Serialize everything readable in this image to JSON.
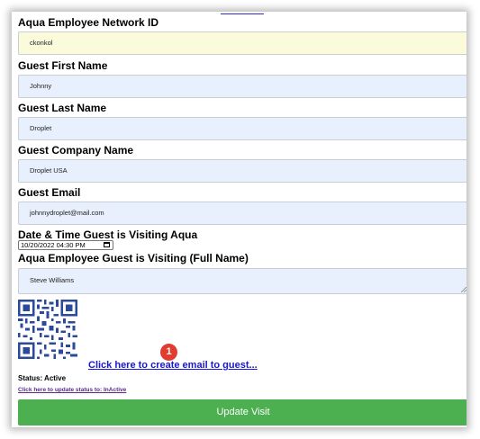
{
  "form": {
    "employee_id": {
      "label": "Aqua Employee Network ID",
      "value": "ckonkol"
    },
    "first_name": {
      "label": "Guest First Name",
      "value": "Johnny"
    },
    "last_name": {
      "label": "Guest Last Name",
      "value": "Droplet"
    },
    "company": {
      "label": "Guest Company Name",
      "value": "Droplet USA"
    },
    "email": {
      "label": "Guest Email",
      "value": "johnnydroplet@mail.com"
    },
    "visit_datetime": {
      "label": "Date & Time Guest is Visiting Aqua",
      "value": "10/20/2022 04:30 PM"
    },
    "employee_visiting": {
      "label": "Aqua Employee Guest is Visiting (Full Name)",
      "value": "Steve Williams"
    }
  },
  "email_link_label": "Click here to create email to guest...",
  "callout_number": "1",
  "status_text": "Status: Active",
  "status_link_label": "Click here to update status to: InActive",
  "update_button_label": "Update Visit",
  "icons": {
    "calendar": "calendar-icon",
    "qr_code": "qr-code"
  },
  "colors": {
    "button": "#4caf50",
    "link": "#1a17d6",
    "visited_link": "#5a2a8a",
    "callout": "#e23b2f",
    "field_autofill_blue": "#e8f0fe",
    "field_autofill_yellow": "#fbfbdc"
  }
}
